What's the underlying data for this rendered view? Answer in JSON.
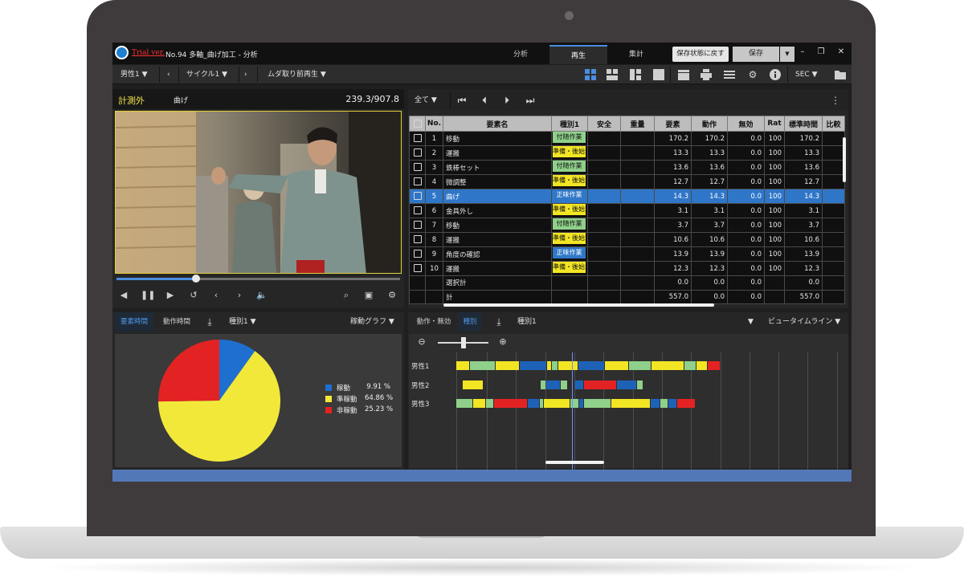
{
  "titlebar": {
    "trial_label": "Trial ver.",
    "file_title": "No.94 多軸_曲げ加工 - 分析",
    "tabs": [
      "分析",
      "再生",
      "集計"
    ],
    "active_tab": "再生",
    "revert_label": "保存状態に戻す",
    "save_label": "保存"
  },
  "toolbar": {
    "worker": "男性1",
    "cycle": "サイクル1",
    "playback_mode": "ムダ取り前再生",
    "unit": "SEC"
  },
  "video": {
    "status": "計測外",
    "element": "曲げ",
    "time": "239.3/907.8",
    "seek_progress": 0.28
  },
  "table": {
    "filter": "全て",
    "headers": [
      "No.",
      "要素名",
      "種別1",
      "安全",
      "重量",
      "要素",
      "動作",
      "無効",
      "Rat",
      "標準時間",
      "比較"
    ],
    "rows": [
      {
        "no": "1",
        "name": "移動",
        "category": "付随作業",
        "element": "170.2",
        "motion": "170.2",
        "invalid": "0.0",
        "rate": "100",
        "std": "170.2"
      },
      {
        "no": "2",
        "name": "運搬",
        "category": "準備・後始末",
        "element": "13.3",
        "motion": "13.3",
        "invalid": "0.0",
        "rate": "100",
        "std": "13.3"
      },
      {
        "no": "3",
        "name": "鉄棒セット",
        "category": "付随作業",
        "element": "13.6",
        "motion": "13.6",
        "invalid": "0.0",
        "rate": "100",
        "std": "13.6"
      },
      {
        "no": "4",
        "name": "微調整",
        "category": "準備・後始末",
        "element": "12.7",
        "motion": "12.7",
        "invalid": "0.0",
        "rate": "100",
        "std": "12.7"
      },
      {
        "no": "5",
        "name": "曲げ",
        "category": "正味作業",
        "element": "14.3",
        "motion": "14.3",
        "invalid": "0.0",
        "rate": "100",
        "std": "14.3"
      },
      {
        "no": "6",
        "name": "金具外し",
        "category": "準備・後始末",
        "element": "3.1",
        "motion": "3.1",
        "invalid": "0.0",
        "rate": "100",
        "std": "3.1"
      },
      {
        "no": "7",
        "name": "移動",
        "category": "付随作業",
        "element": "3.7",
        "motion": "3.7",
        "invalid": "0.0",
        "rate": "100",
        "std": "3.7"
      },
      {
        "no": "8",
        "name": "運搬",
        "category": "準備・後始末",
        "element": "10.6",
        "motion": "10.6",
        "invalid": "0.0",
        "rate": "100",
        "std": "10.6"
      },
      {
        "no": "9",
        "name": "角度の確認",
        "category": "正味作業",
        "element": "13.9",
        "motion": "13.9",
        "invalid": "0.0",
        "rate": "100",
        "std": "13.9"
      },
      {
        "no": "10",
        "name": "運搬",
        "category": "準備・後始末",
        "element": "12.3",
        "motion": "12.3",
        "invalid": "0.0",
        "rate": "100",
        "std": "12.3"
      }
    ],
    "selected_row": 4,
    "summary": [
      {
        "label": "選択計",
        "element": "0.0",
        "motion": "0.0",
        "invalid": "0.0",
        "std": "0.0"
      },
      {
        "label": "計",
        "element": "557.0",
        "motion": "0.0",
        "invalid": "0.0",
        "std": "557.0"
      }
    ],
    "category_colors": {
      "付随作業": "#8fd08a",
      "準備・後始末": "#f2e524",
      "正味作業": "#2f78c8"
    }
  },
  "chart_panel": {
    "tabs": [
      "要素時間",
      "動作時間"
    ],
    "active_tab": "要素時間",
    "category": "種別1",
    "graph_type": "稼動グラフ"
  },
  "chart_data": {
    "type": "pie",
    "categories": [
      "稼動",
      "準稼動",
      "非稼動"
    ],
    "values": [
      9.91,
      64.86,
      25.23
    ],
    "value_labels": [
      "9.91 %",
      "64.86 %",
      "25.23 %"
    ],
    "colors": [
      "#1f6fd0",
      "#f2e83a",
      "#e32323"
    ],
    "legend_position": "right"
  },
  "timeline": {
    "tabs": [
      "動作・無効",
      "種別"
    ],
    "active_tab": "種別",
    "category": "種別1",
    "view": "ビュータイムライン",
    "workers": [
      "男性1",
      "男性2",
      "男性3"
    ],
    "ticks": [
      "0",
      "210.0",
      "220.0",
      "230.0",
      "240.0",
      "250.0",
      "260.0",
      "270.0",
      "280.0",
      "290.0",
      "300.0",
      "310.0",
      "320.0",
      "330.0"
    ],
    "playhead": 239.3,
    "zoom_level": 0.5,
    "colors": {
      "green": "#8fd08a",
      "yellow": "#f2e524",
      "blue": "#1e62b8",
      "red": "#e32323"
    },
    "lanes": [
      [
        [
          "yellow",
          199.5,
          204.2
        ],
        [
          "green",
          204.2,
          213.0
        ],
        [
          "yellow",
          213.0,
          221.4
        ],
        [
          "blue",
          221.4,
          230.6
        ],
        [
          "yellow",
          230.6,
          232.3
        ],
        [
          "green",
          232.3,
          234.4
        ],
        [
          "yellow",
          234.4,
          241.3
        ],
        [
          "blue",
          241.3,
          250.4
        ],
        [
          "yellow",
          250.4,
          258.6
        ],
        [
          "green",
          258.6,
          266.5
        ],
        [
          "yellow",
          266.5,
          277.7
        ],
        [
          "green",
          277.7,
          282.0
        ],
        [
          "yellow",
          282.0,
          285.8
        ],
        [
          "red",
          285.8,
          290.0
        ]
      ],
      [
        [
          "yellow",
          201.6,
          209.0
        ],
        [
          "green",
          228.3,
          230.3
        ],
        [
          "blue",
          230.3,
          235.3
        ],
        [
          "green",
          235.3,
          237.8
        ],
        [
          "blue",
          240.2,
          243.2
        ],
        [
          "red",
          243.2,
          254.6
        ],
        [
          "blue",
          254.6,
          261.4
        ],
        [
          "green",
          261.4,
          263.6
        ]
      ],
      [
        [
          "green",
          199.5,
          205.2
        ],
        [
          "yellow",
          205.2,
          209.7
        ],
        [
          "green",
          209.7,
          212.5
        ],
        [
          "red",
          212.5,
          223.9
        ],
        [
          "blue",
          223.9,
          228.1
        ],
        [
          "green",
          228.1,
          229.5
        ],
        [
          "yellow",
          229.5,
          238.5
        ],
        [
          "green",
          238.5,
          241.6
        ],
        [
          "blue",
          241.6,
          243.3
        ],
        [
          "green",
          243.3,
          252.7
        ],
        [
          "yellow",
          252.7,
          266.1
        ],
        [
          "blue",
          266.1,
          269.6
        ],
        [
          "green",
          269.6,
          272.3
        ],
        [
          "blue",
          272.3,
          275.2
        ],
        [
          "red",
          275.2,
          281.5
        ]
      ]
    ]
  }
}
